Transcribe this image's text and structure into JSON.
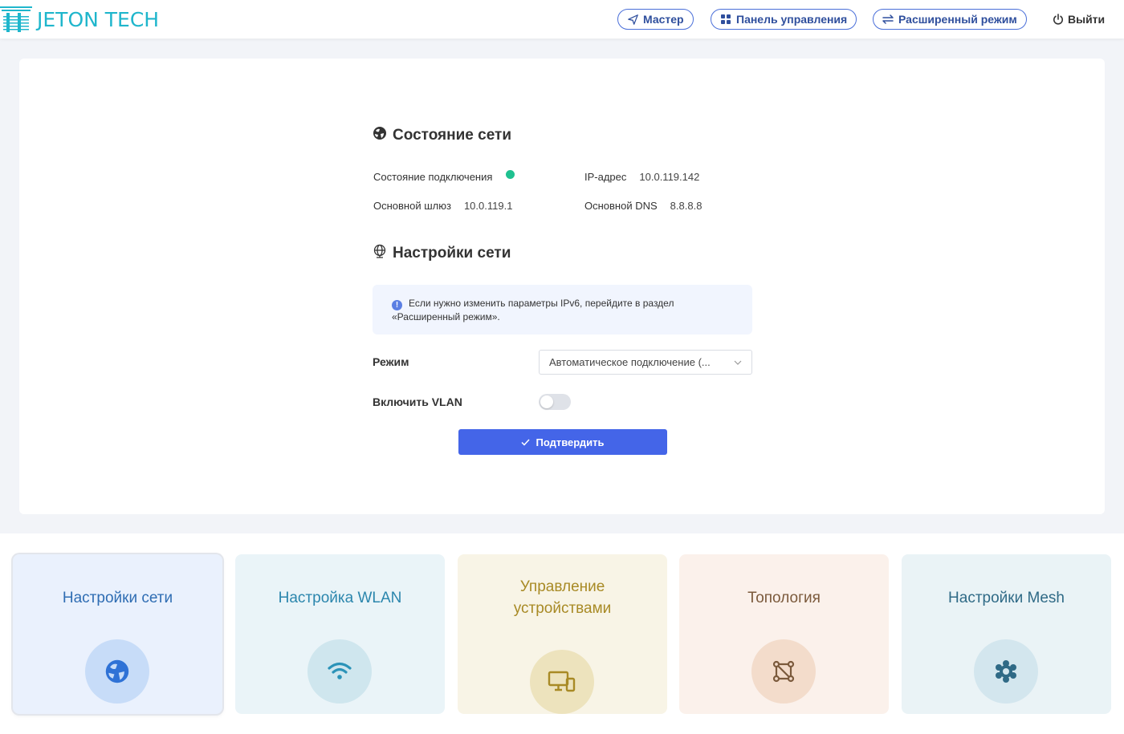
{
  "header": {
    "logo_text": "JETON TECH",
    "nav": [
      {
        "label": "Мастер",
        "icon": "send-icon"
      },
      {
        "label": "Панель управления",
        "icon": "grid-icon"
      },
      {
        "label": "Расширенный режим",
        "icon": "swap-icon"
      }
    ],
    "logout_label": "Выйти",
    "logout_icon": "power-icon"
  },
  "status": {
    "title": "Состояние сети",
    "icon": "globe-icon",
    "connection_label": "Состояние подключения",
    "connection_state_color": "#1fc190",
    "ip_label": "IP-адрес",
    "ip_value": "10.0.119.142",
    "gateway_label": "Основной шлюз",
    "gateway_value": "10.0.119.1",
    "dns_label": "Основной DNS",
    "dns_value": "8.8.8.8"
  },
  "settings": {
    "title": "Настройки сети",
    "icon": "network-icon",
    "info_text_1": "Если нужно изменить параметры IPv6, перейдите в раздел",
    "info_text_2": "«Расширенный режим».",
    "mode_label": "Режим",
    "mode_value": "Автоматическое подключение (...",
    "vlan_label": "Включить VLAN",
    "vlan_enabled": false,
    "confirm_label": "Подтвердить"
  },
  "tiles": [
    {
      "label": "Настройки сети",
      "icon": "globe-icon",
      "color": "#2f6db3",
      "bg": "#eaf1fd",
      "circle": "#c7dcf8"
    },
    {
      "label": "Настройка WLAN",
      "icon": "wifi-icon",
      "color": "#2b86ad",
      "bg": "#eaf4f8",
      "circle": "#cfe6ee"
    },
    {
      "label_line1": "Управление",
      "label_line2": "устройствами",
      "icon": "devices-icon",
      "color": "#a88a25",
      "bg": "#f8f4e6",
      "circle": "#ede3bd"
    },
    {
      "label": "Топология",
      "icon": "topology-icon",
      "color": "#7b5a3c",
      "bg": "#fbf1eb",
      "circle": "#f3dccb"
    },
    {
      "label": "Настройки Mesh",
      "icon": "gear-icon",
      "color": "#2f6a86",
      "bg": "#eaf3f6",
      "circle": "#d3e6ee"
    }
  ]
}
